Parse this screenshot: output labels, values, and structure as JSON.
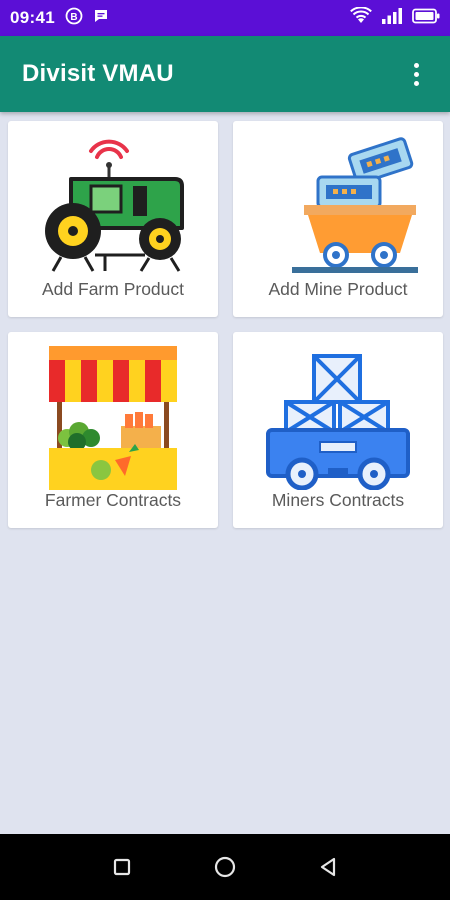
{
  "status_bar": {
    "time": "09:41",
    "icons": [
      "b-circle-notification-icon",
      "message-notification-icon",
      "wifi-icon",
      "signal-icon",
      "battery-icon"
    ]
  },
  "app_bar": {
    "title": "Divisit VMAU",
    "menu_icon": "more-vertical-icon"
  },
  "cards": [
    {
      "label": "Add Farm Product",
      "icon": "tractor-icon"
    },
    {
      "label": "Add Mine Product",
      "icon": "mine-cart-icon"
    },
    {
      "label": "Farmer Contracts",
      "icon": "market-stall-icon"
    },
    {
      "label": "Miners Contracts",
      "icon": "cargo-truck-icon"
    }
  ],
  "nav_bar": {
    "icons": [
      "recent-apps-icon",
      "home-icon",
      "back-icon"
    ]
  },
  "colors": {
    "status_bar": "#5b0fd6",
    "app_bar": "#128a74",
    "background": "#dfe3ef"
  }
}
